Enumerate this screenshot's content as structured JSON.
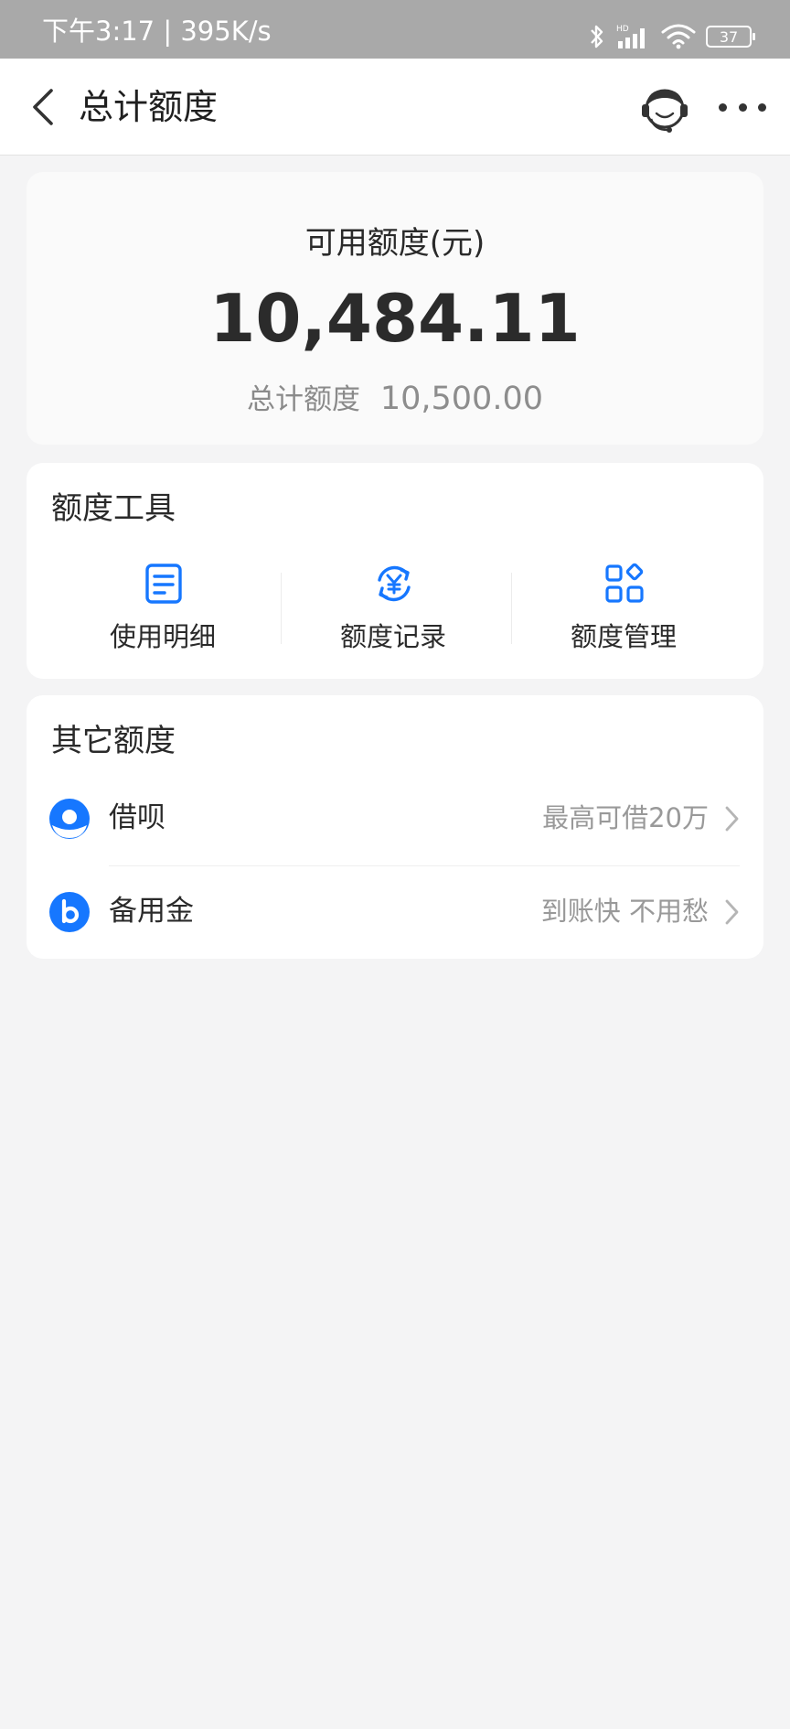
{
  "status_bar": {
    "time": "下午3:17",
    "net_speed": "395K/s",
    "network_label": "HD",
    "battery": "37"
  },
  "header": {
    "title": "总计额度"
  },
  "balance": {
    "available_label": "可用额度(元)",
    "available_amount": "10,484.11",
    "total_label": "总计额度",
    "total_amount": "10,500.00"
  },
  "tools": {
    "title": "额度工具",
    "items": [
      {
        "label": "使用明细",
        "icon": "document-list-icon"
      },
      {
        "label": "额度记录",
        "icon": "yuan-cycle-icon"
      },
      {
        "label": "额度管理",
        "icon": "grid-manage-icon"
      }
    ]
  },
  "other": {
    "title": "其它额度",
    "items": [
      {
        "name": "借呗",
        "hint": "最高可借20万",
        "icon": "jiebei-icon"
      },
      {
        "name": "备用金",
        "hint": "到账快 不用愁",
        "icon": "beiyongjin-icon"
      }
    ]
  },
  "colors": {
    "accent": "#1677ff",
    "status_bar": "#a9a9a9",
    "background": "#f4f4f5"
  }
}
